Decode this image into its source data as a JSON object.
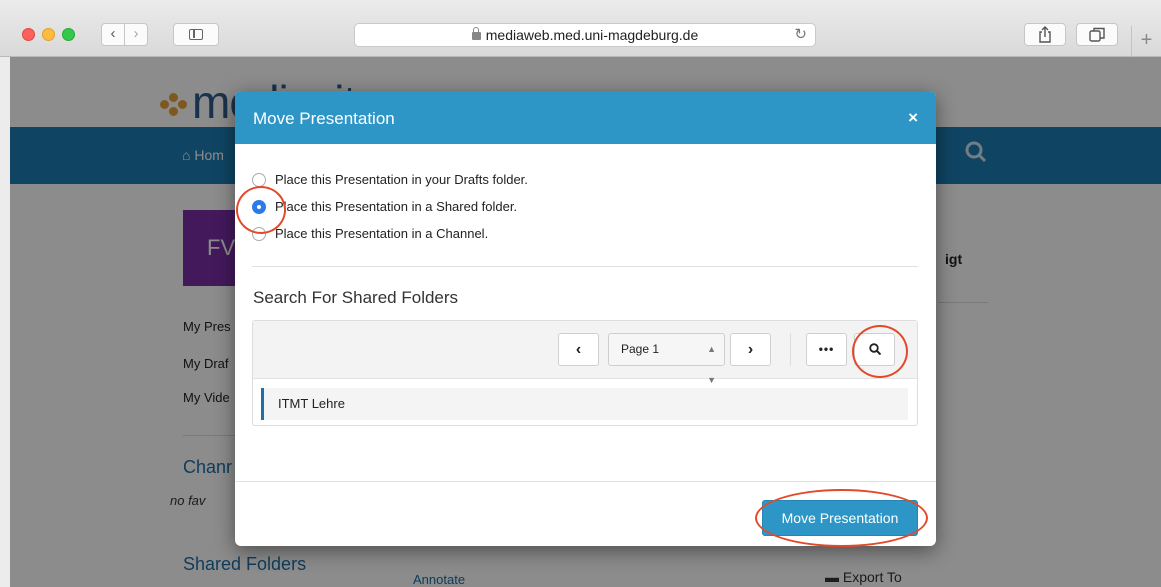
{
  "browser": {
    "url": "mediaweb.med.uni-magdeburg.de",
    "back_glyph": "‹",
    "forward_glyph": "›",
    "reload_glyph": "↻",
    "new_tab_glyph": "+"
  },
  "page": {
    "logo_text": "mediasite",
    "nav_home": "Hom",
    "avatar_initials": "FV",
    "side_links": [
      "My Pres",
      "My Draf",
      "My Vide"
    ],
    "channels_heading": "Chanr",
    "channels_note": "no fav",
    "shared_folders_heading": "Shared Folders",
    "owner_name_fragment": "igt",
    "annotate_link": "Annotate",
    "export_label": "Export To"
  },
  "modal": {
    "title": "Move Presentation",
    "close_glyph": "×",
    "options": [
      {
        "label": "Place this Presentation in your Drafts folder.",
        "selected": false
      },
      {
        "label": "Place this Presentation in a Shared folder.",
        "selected": true
      },
      {
        "label": "Place this Presentation in a Channel.",
        "selected": false
      }
    ],
    "search_heading": "Search For Shared Folders",
    "pager": {
      "prev_glyph": "‹",
      "page_label": "Page 1",
      "select_arrows": "▲▼",
      "next_glyph": "›",
      "more_glyph": "•••"
    },
    "folders": [
      "ITMT Lehre"
    ],
    "move_button": "Move Presentation"
  },
  "colors": {
    "modal_header": "#2e96c6",
    "primary_button": "#2e96c6",
    "annotation_ring": "#e3492b",
    "radio_selected": "#2e7be6"
  }
}
